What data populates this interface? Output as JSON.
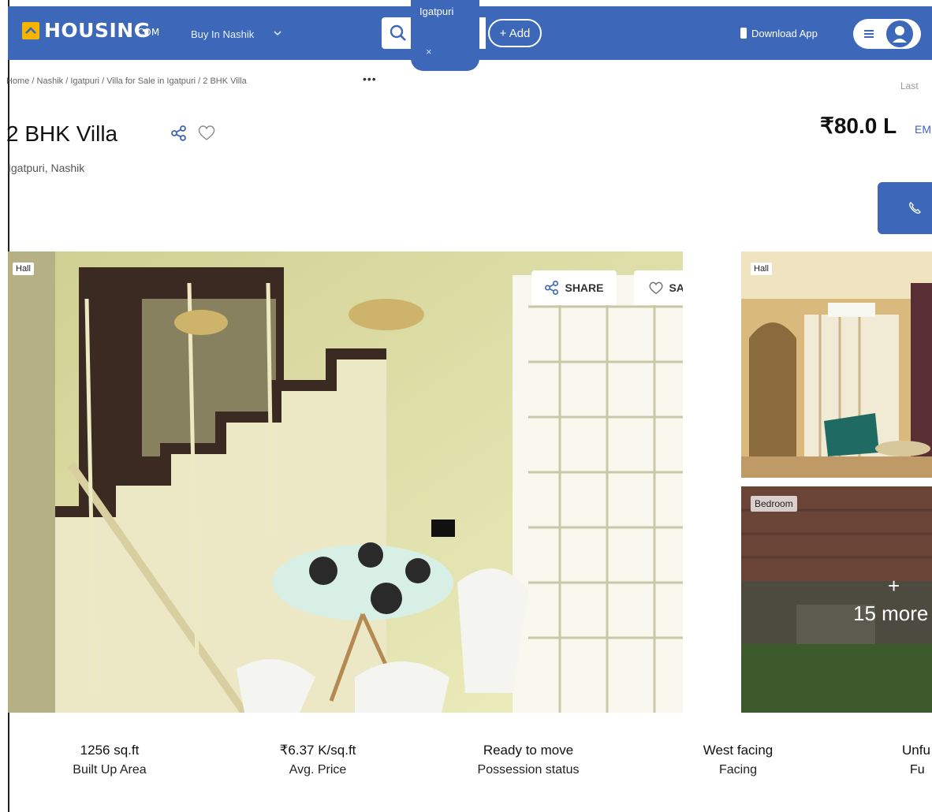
{
  "header": {
    "logo_text": "HOUSING",
    "logo_suffix": "COM",
    "buy_in_label": "Buy In Nashik",
    "search_location": "Igatpuri",
    "search_location_remove": "×",
    "add_label": "+ Add",
    "download_app_label": "Download App",
    "colors": {
      "brand": "#3d67b8",
      "logo_accent": "#f6b400"
    }
  },
  "breadcrumb": {
    "items": [
      "Home",
      "Nashik",
      "Igatpuri",
      "Villa for Sale in Igatpuri",
      "2 BHK Villa"
    ],
    "separator": " / ",
    "more": "•••",
    "last_label": "Last"
  },
  "listing": {
    "title": "2 BHK Villa",
    "location": "Igatpuri, Nashik",
    "price": "₹80.0 L",
    "emi_label": "EM"
  },
  "gallery": {
    "main_tag": "Hall",
    "share_label": "SHARE",
    "save_label": "SAVE",
    "side1_tag": "Hall",
    "side2_tag": "Bedroom",
    "more_plus": "+",
    "more_label": "15 more"
  },
  "stats": [
    {
      "value": "1256 sq.ft",
      "label": "Built Up Area"
    },
    {
      "value": "₹6.37 K/sq.ft",
      "label": "Avg. Price"
    },
    {
      "value": "Ready to move",
      "label": "Possession status"
    },
    {
      "value": "West facing",
      "label": "Facing"
    },
    {
      "value": "Unfu",
      "label": "Fu"
    }
  ],
  "icons": [
    "house-logo-icon",
    "chevron-down-icon",
    "search-icon",
    "phone-icon",
    "menu-icon",
    "user-avatar-icon",
    "share-icon",
    "heart-icon",
    "call-icon"
  ]
}
